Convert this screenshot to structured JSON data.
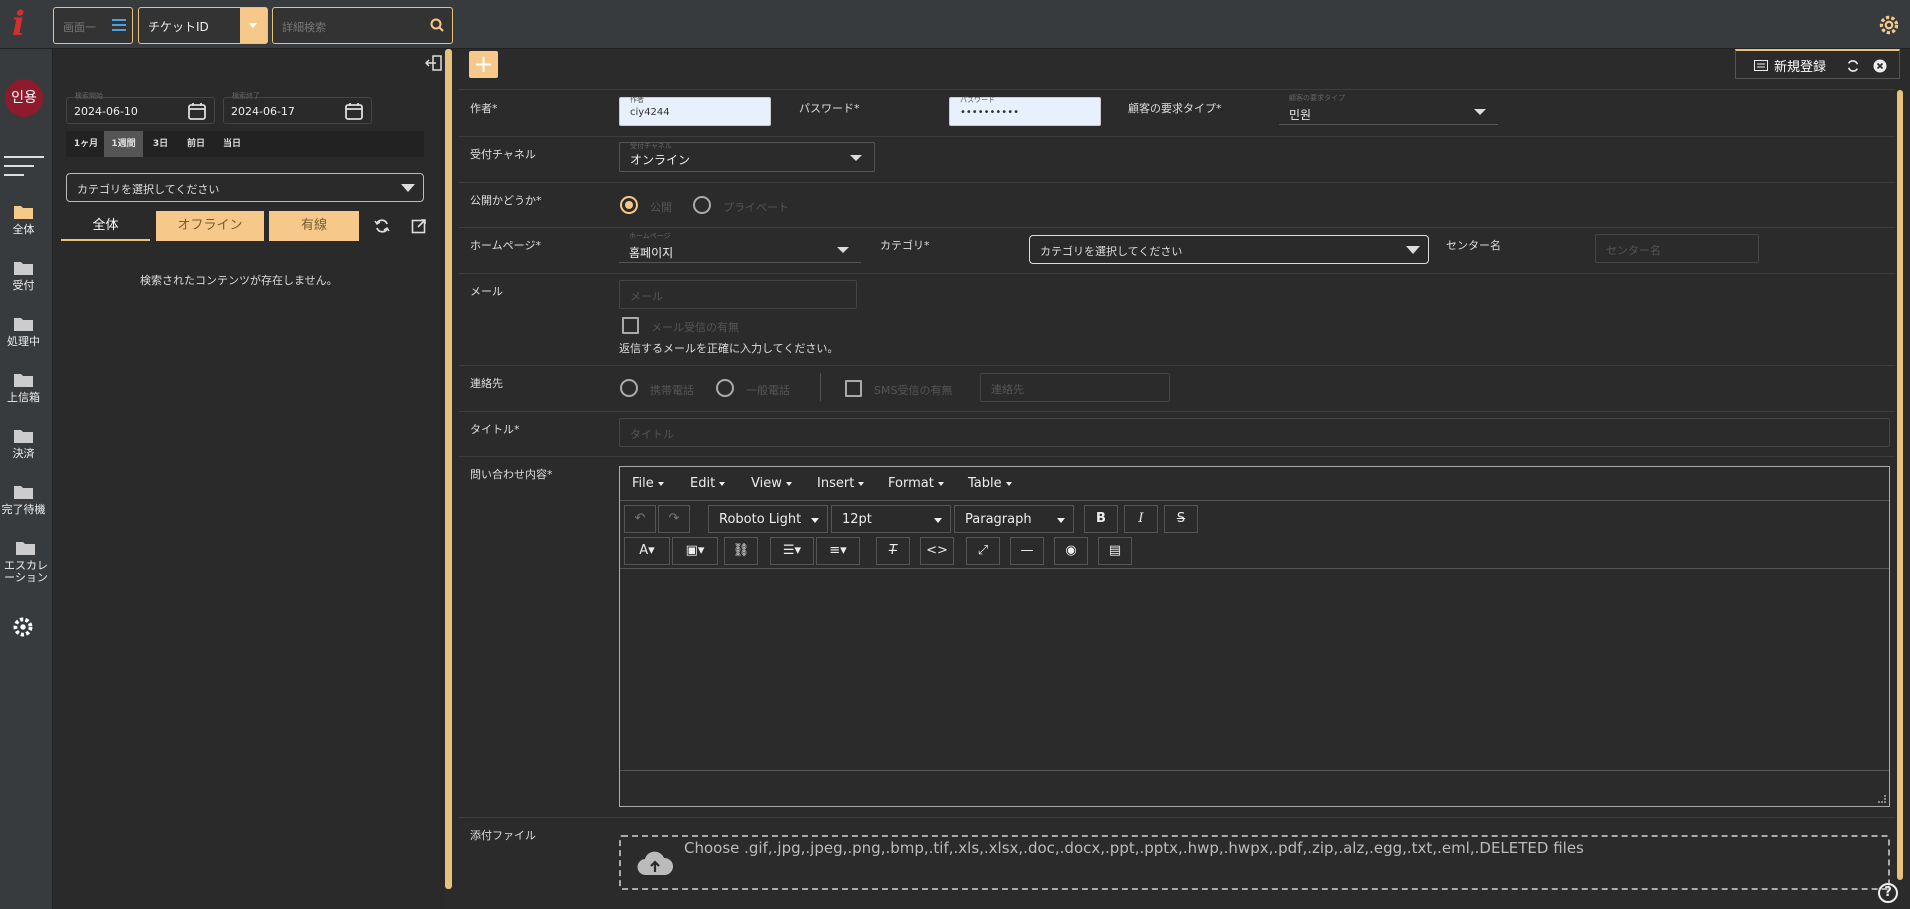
{
  "topbar": {
    "logo": "i",
    "filter_placeholder": "画面一",
    "search_type": "チケットID",
    "search_placeholder": "詳細検索",
    "settings_icon": "gear-icon"
  },
  "nav": {
    "avatar": "인용",
    "items": [
      {
        "label": "全体",
        "icon": "folder-open-icon",
        "color": "#f6c98a"
      },
      {
        "label": "受付",
        "icon": "folder-icon"
      },
      {
        "label": "処理中",
        "icon": "folder-icon"
      },
      {
        "label": "上信箱",
        "icon": "folder-icon"
      },
      {
        "label": "決済",
        "icon": "folder-icon"
      },
      {
        "label": "完了待機",
        "icon": "folder-icon"
      },
      {
        "label": "エスカレーション",
        "icon": "folder-icon"
      }
    ]
  },
  "left": {
    "start_label": "検索開始",
    "start_date": "2024-06-10",
    "end_label": "検索終了",
    "end_date": "2024-06-17",
    "ranges": [
      "1ヶ月",
      "1週間",
      "3日",
      "前日",
      "当日"
    ],
    "selected_range": "1週間",
    "category_placeholder": "カテゴリを選択してください",
    "tabs": [
      "全体",
      "オフライン",
      "有線"
    ],
    "empty_message": "検索されたコンテンツが存在しません。"
  },
  "right": {
    "tab_title": "新規登録",
    "form": {
      "author_label": "作者*",
      "author_float": "作者",
      "author_value": "ciy4244",
      "password_label": "パスワード*",
      "password_float": "パスワード",
      "password_value": "••••••••••",
      "request_type_label": "顧客の要求タイプ*",
      "request_type_float": "顧客の要求タイプ",
      "request_type_value": "민원",
      "channel_label": "受付チャネル",
      "channel_float": "受付チャネル",
      "channel_value": "オンライン",
      "public_label": "公開かどうか*",
      "public_option": "公開",
      "private_option": "プライベート",
      "homepage_label": "ホームページ*",
      "homepage_float": "ホームページ",
      "homepage_value": "홈페이지",
      "category_label": "カテゴリ*",
      "category_placeholder": "カテゴリを選択してください",
      "center_label": "センター名",
      "center_placeholder": "センター名",
      "email_label": "メール",
      "email_placeholder": "メール",
      "email_receive": "メール受信の有無",
      "email_note": "返信するメールを正確に入力してください。",
      "contact_label": "連絡先",
      "mobile_option": "携帯電話",
      "landline_option": "一般電話",
      "sms_receive": "SMS受信の有無",
      "contact_placeholder": "連絡先",
      "title_label": "タイトル*",
      "title_placeholder": "タイトル",
      "content_label": "問い合わせ内容*",
      "attachment_label": "添付ファイル"
    },
    "editor": {
      "menus": [
        "File",
        "Edit",
        "View",
        "Insert",
        "Format",
        "Table"
      ],
      "font": "Roboto Light",
      "size": "12pt",
      "block": "Paragraph",
      "bold": "B",
      "italic": "I",
      "strike": "S"
    },
    "upload_text": "Choose .gif,.jpg,.jpeg,.png,.bmp,.tif,.xls,.xlsx,.doc,.docx,.ppt,.pptx,.hwp,.hwpx,.pdf,.zip,.alz,.egg,.txt,.eml,.DELETED files",
    "help": "?"
  },
  "colors": {
    "accent": "#f6c98a",
    "logo": "#d32f2f",
    "avatar": "#8e1b2c"
  }
}
